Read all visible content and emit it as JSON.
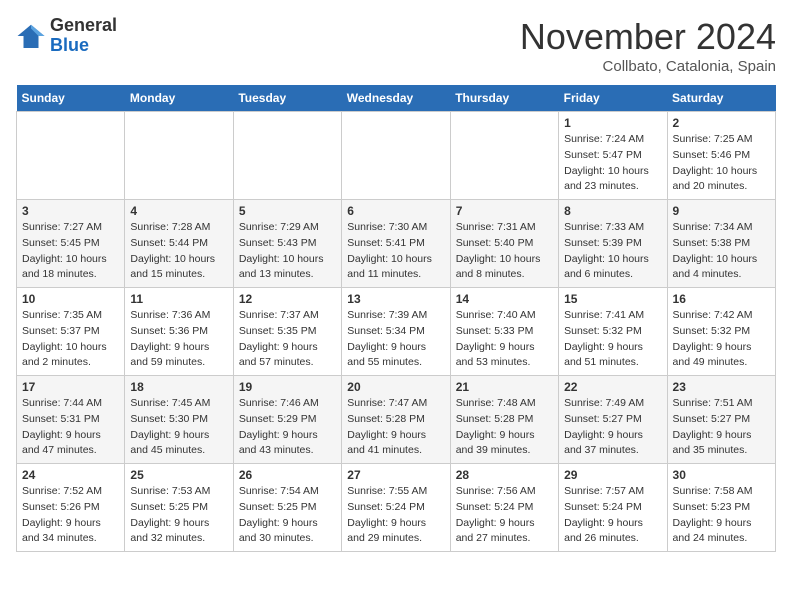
{
  "header": {
    "logo_line1": "General",
    "logo_line2": "Blue",
    "month": "November 2024",
    "location": "Collbato, Catalonia, Spain"
  },
  "days_of_week": [
    "Sunday",
    "Monday",
    "Tuesday",
    "Wednesday",
    "Thursday",
    "Friday",
    "Saturday"
  ],
  "weeks": [
    [
      {
        "day": "",
        "info": ""
      },
      {
        "day": "",
        "info": ""
      },
      {
        "day": "",
        "info": ""
      },
      {
        "day": "",
        "info": ""
      },
      {
        "day": "",
        "info": ""
      },
      {
        "day": "1",
        "info": "Sunrise: 7:24 AM\nSunset: 5:47 PM\nDaylight: 10 hours and 23 minutes."
      },
      {
        "day": "2",
        "info": "Sunrise: 7:25 AM\nSunset: 5:46 PM\nDaylight: 10 hours and 20 minutes."
      }
    ],
    [
      {
        "day": "3",
        "info": "Sunrise: 7:27 AM\nSunset: 5:45 PM\nDaylight: 10 hours and 18 minutes."
      },
      {
        "day": "4",
        "info": "Sunrise: 7:28 AM\nSunset: 5:44 PM\nDaylight: 10 hours and 15 minutes."
      },
      {
        "day": "5",
        "info": "Sunrise: 7:29 AM\nSunset: 5:43 PM\nDaylight: 10 hours and 13 minutes."
      },
      {
        "day": "6",
        "info": "Sunrise: 7:30 AM\nSunset: 5:41 PM\nDaylight: 10 hours and 11 minutes."
      },
      {
        "day": "7",
        "info": "Sunrise: 7:31 AM\nSunset: 5:40 PM\nDaylight: 10 hours and 8 minutes."
      },
      {
        "day": "8",
        "info": "Sunrise: 7:33 AM\nSunset: 5:39 PM\nDaylight: 10 hours and 6 minutes."
      },
      {
        "day": "9",
        "info": "Sunrise: 7:34 AM\nSunset: 5:38 PM\nDaylight: 10 hours and 4 minutes."
      }
    ],
    [
      {
        "day": "10",
        "info": "Sunrise: 7:35 AM\nSunset: 5:37 PM\nDaylight: 10 hours and 2 minutes."
      },
      {
        "day": "11",
        "info": "Sunrise: 7:36 AM\nSunset: 5:36 PM\nDaylight: 9 hours and 59 minutes."
      },
      {
        "day": "12",
        "info": "Sunrise: 7:37 AM\nSunset: 5:35 PM\nDaylight: 9 hours and 57 minutes."
      },
      {
        "day": "13",
        "info": "Sunrise: 7:39 AM\nSunset: 5:34 PM\nDaylight: 9 hours and 55 minutes."
      },
      {
        "day": "14",
        "info": "Sunrise: 7:40 AM\nSunset: 5:33 PM\nDaylight: 9 hours and 53 minutes."
      },
      {
        "day": "15",
        "info": "Sunrise: 7:41 AM\nSunset: 5:32 PM\nDaylight: 9 hours and 51 minutes."
      },
      {
        "day": "16",
        "info": "Sunrise: 7:42 AM\nSunset: 5:32 PM\nDaylight: 9 hours and 49 minutes."
      }
    ],
    [
      {
        "day": "17",
        "info": "Sunrise: 7:44 AM\nSunset: 5:31 PM\nDaylight: 9 hours and 47 minutes."
      },
      {
        "day": "18",
        "info": "Sunrise: 7:45 AM\nSunset: 5:30 PM\nDaylight: 9 hours and 45 minutes."
      },
      {
        "day": "19",
        "info": "Sunrise: 7:46 AM\nSunset: 5:29 PM\nDaylight: 9 hours and 43 minutes."
      },
      {
        "day": "20",
        "info": "Sunrise: 7:47 AM\nSunset: 5:28 PM\nDaylight: 9 hours and 41 minutes."
      },
      {
        "day": "21",
        "info": "Sunrise: 7:48 AM\nSunset: 5:28 PM\nDaylight: 9 hours and 39 minutes."
      },
      {
        "day": "22",
        "info": "Sunrise: 7:49 AM\nSunset: 5:27 PM\nDaylight: 9 hours and 37 minutes."
      },
      {
        "day": "23",
        "info": "Sunrise: 7:51 AM\nSunset: 5:27 PM\nDaylight: 9 hours and 35 minutes."
      }
    ],
    [
      {
        "day": "24",
        "info": "Sunrise: 7:52 AM\nSunset: 5:26 PM\nDaylight: 9 hours and 34 minutes."
      },
      {
        "day": "25",
        "info": "Sunrise: 7:53 AM\nSunset: 5:25 PM\nDaylight: 9 hours and 32 minutes."
      },
      {
        "day": "26",
        "info": "Sunrise: 7:54 AM\nSunset: 5:25 PM\nDaylight: 9 hours and 30 minutes."
      },
      {
        "day": "27",
        "info": "Sunrise: 7:55 AM\nSunset: 5:24 PM\nDaylight: 9 hours and 29 minutes."
      },
      {
        "day": "28",
        "info": "Sunrise: 7:56 AM\nSunset: 5:24 PM\nDaylight: 9 hours and 27 minutes."
      },
      {
        "day": "29",
        "info": "Sunrise: 7:57 AM\nSunset: 5:24 PM\nDaylight: 9 hours and 26 minutes."
      },
      {
        "day": "30",
        "info": "Sunrise: 7:58 AM\nSunset: 5:23 PM\nDaylight: 9 hours and 24 minutes."
      }
    ]
  ]
}
